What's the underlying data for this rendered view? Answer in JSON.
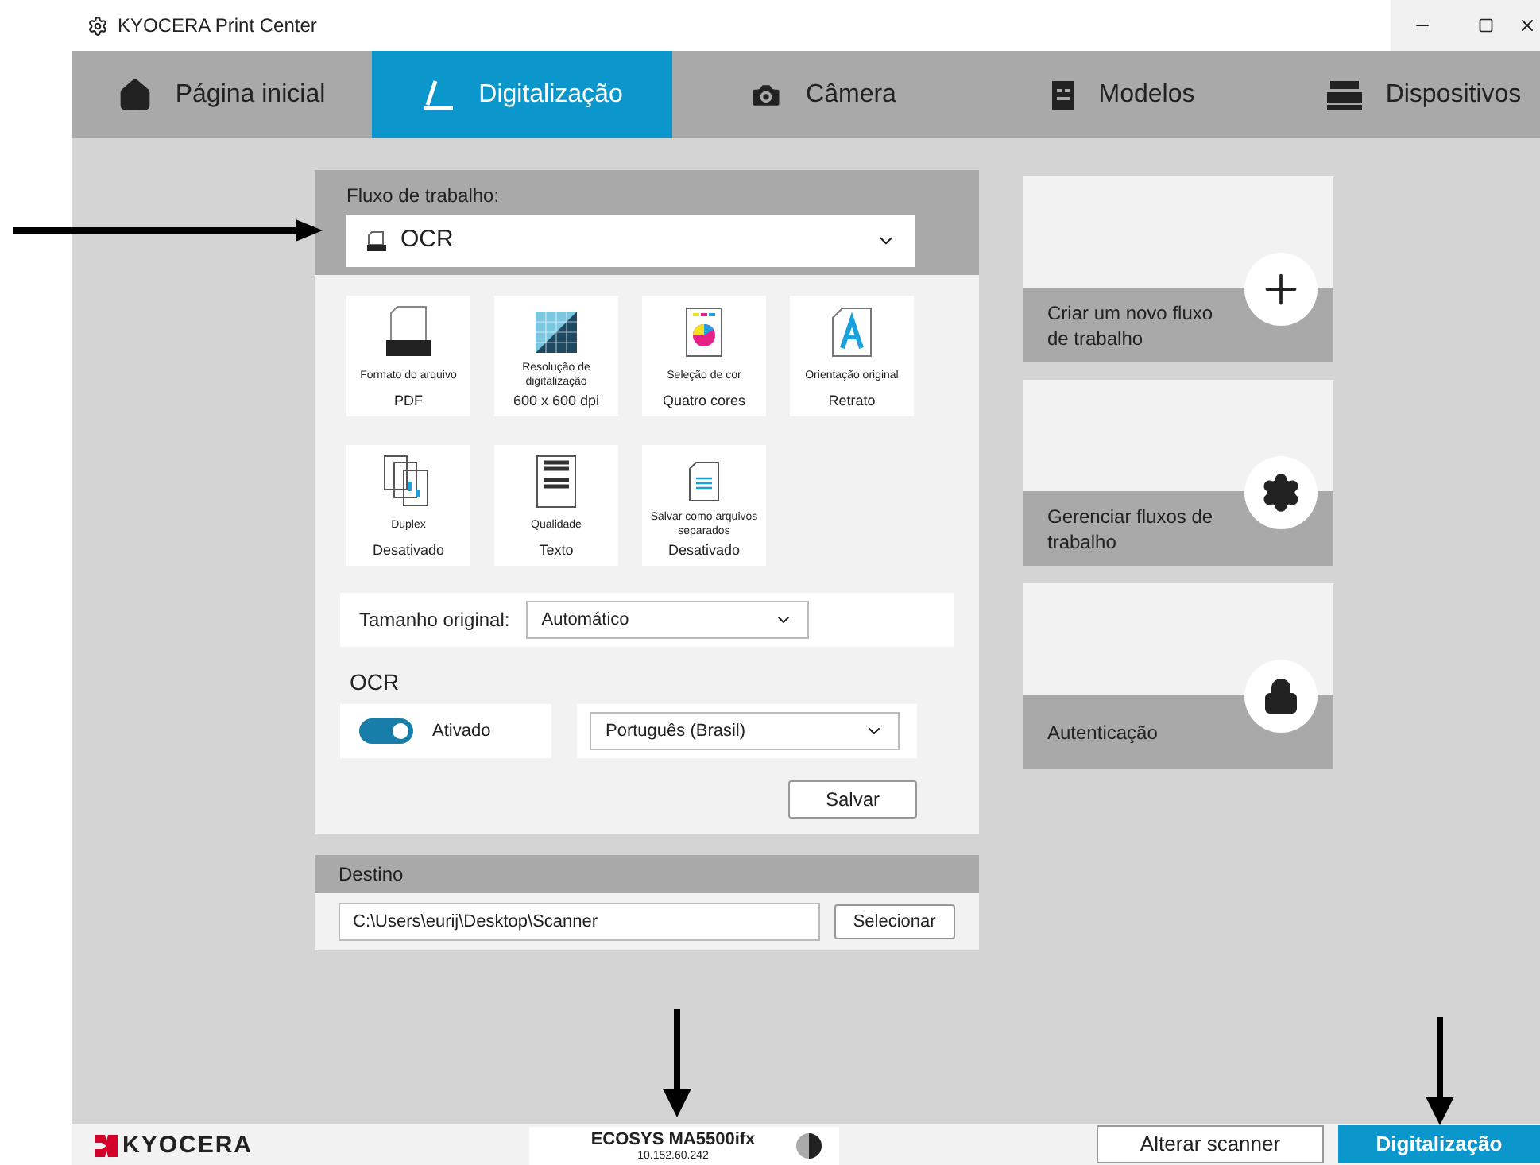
{
  "window": {
    "title": "KYOCERA Print Center"
  },
  "tabs": [
    {
      "label": "Página inicial",
      "kind": "home",
      "selected": false
    },
    {
      "label": "Digitalização",
      "kind": "scan",
      "selected": true
    },
    {
      "label": "Câmera",
      "kind": "camera",
      "selected": false
    },
    {
      "label": "Modelos",
      "kind": "template",
      "selected": false
    },
    {
      "label": "Dispositivos",
      "kind": "printer",
      "selected": false
    }
  ],
  "workflow": {
    "label": "Fluxo de trabalho:",
    "value": "OCR"
  },
  "settings": [
    {
      "kind": "pdf",
      "title": "Formato do arquivo",
      "value": "PDF"
    },
    {
      "kind": "resolution",
      "title": "Resolução de digitalização",
      "value": "600 x 600 dpi"
    },
    {
      "kind": "color",
      "title": "Seleção de cor",
      "value": "Quatro cores"
    },
    {
      "kind": "orientation",
      "title": "Orientação original",
      "value": "Retrato"
    },
    {
      "kind": "duplex",
      "title": "Duplex",
      "value": "Desativado"
    },
    {
      "kind": "quality",
      "title": "Qualidade",
      "value": "Texto"
    },
    {
      "kind": "separate",
      "title": "Salvar como arquivos separados",
      "value": "Desativado"
    }
  ],
  "original_size": {
    "label": "Tamanho original:",
    "value": "Automático"
  },
  "ocr": {
    "heading": "OCR",
    "on": true,
    "toggle_label": "Ativado",
    "language": "Português (Brasil)"
  },
  "save_button": "Salvar",
  "destination": {
    "heading": "Destino",
    "path": "C:\\Users\\eurij\\Desktop\\Scanner",
    "button": "Selecionar"
  },
  "actions": [
    {
      "kind": "plus",
      "label": "Criar um novo fluxo de trabalho"
    },
    {
      "kind": "gear",
      "label": "Gerenciar fluxos de trabalho"
    },
    {
      "kind": "lock",
      "label": "Autenticação"
    }
  ],
  "footer": {
    "logo": "KYOCERA",
    "device_name": "ECOSYS MA5500ifx",
    "device_ip": "10.152.60.242",
    "change_button": "Alterar scanner",
    "scan_button": "Digitalização"
  }
}
